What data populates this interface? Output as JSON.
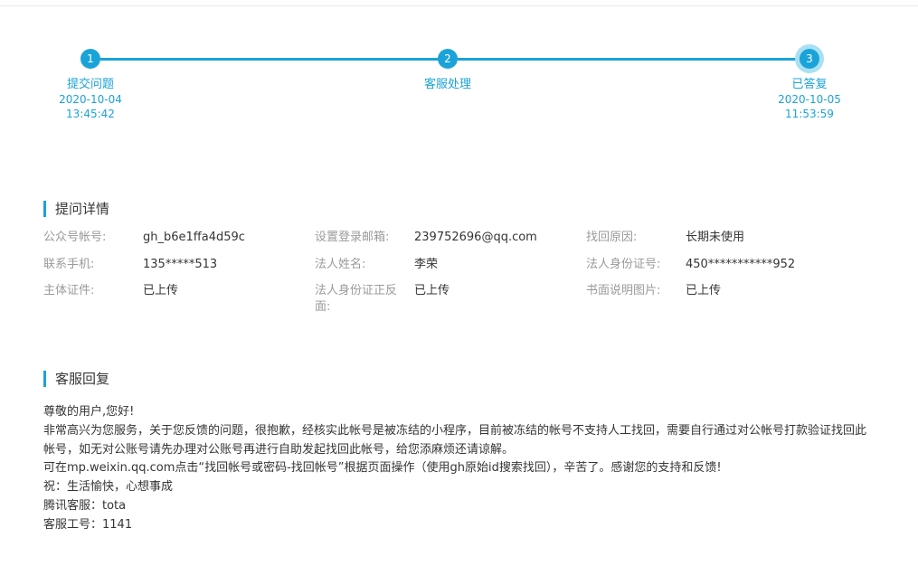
{
  "stepper": {
    "steps": [
      {
        "number": "1",
        "title": "提交问题",
        "date": "2020-10-04",
        "time": "13:45:42"
      },
      {
        "number": "2",
        "title": "客服处理",
        "date": "",
        "time": ""
      },
      {
        "number": "3",
        "title": "已答复",
        "date": "2020-10-05",
        "time": "11:53:59"
      }
    ]
  },
  "details": {
    "title": "提问详情",
    "fields": [
      {
        "label": "公众号帐号:",
        "value": "gh_b6e1ffa4d59c"
      },
      {
        "label": "设置登录邮箱:",
        "value": "239752696@qq.com"
      },
      {
        "label": "找回原因:",
        "value": "长期未使用"
      },
      {
        "label": "联系手机:",
        "value": "135*****513"
      },
      {
        "label": "法人姓名:",
        "value": "李荣"
      },
      {
        "label": "法人身份证号:",
        "value": "450***********952"
      },
      {
        "label": "主体证件:",
        "value": "已上传"
      },
      {
        "label": "法人身份证正反面:",
        "value": "已上传"
      },
      {
        "label": "书面说明图片:",
        "value": "已上传"
      }
    ]
  },
  "reply": {
    "title": "客服回复",
    "lines": [
      "尊敬的用户,您好!",
      "非常高兴为您服务，关于您反馈的问题，很抱歉，经核实此帐号是被冻结的小程序，目前被冻结的帐号不支持人工找回，需要自行通过对公帐号打款验证找回此帐号，如无对公账号请先办理对公账号再进行自助发起找回此帐号，给您添麻烦还请谅解。",
      "可在mp.weixin.qq.com点击“找回帐号或密码-找回帐号”根据页面操作（使用gh原始id搜索找回），辛苦了。感谢您的支持和反馈!",
      "祝：生活愉快，心想事成",
      "腾讯客服：tota",
      "客服工号：1141"
    ]
  }
}
